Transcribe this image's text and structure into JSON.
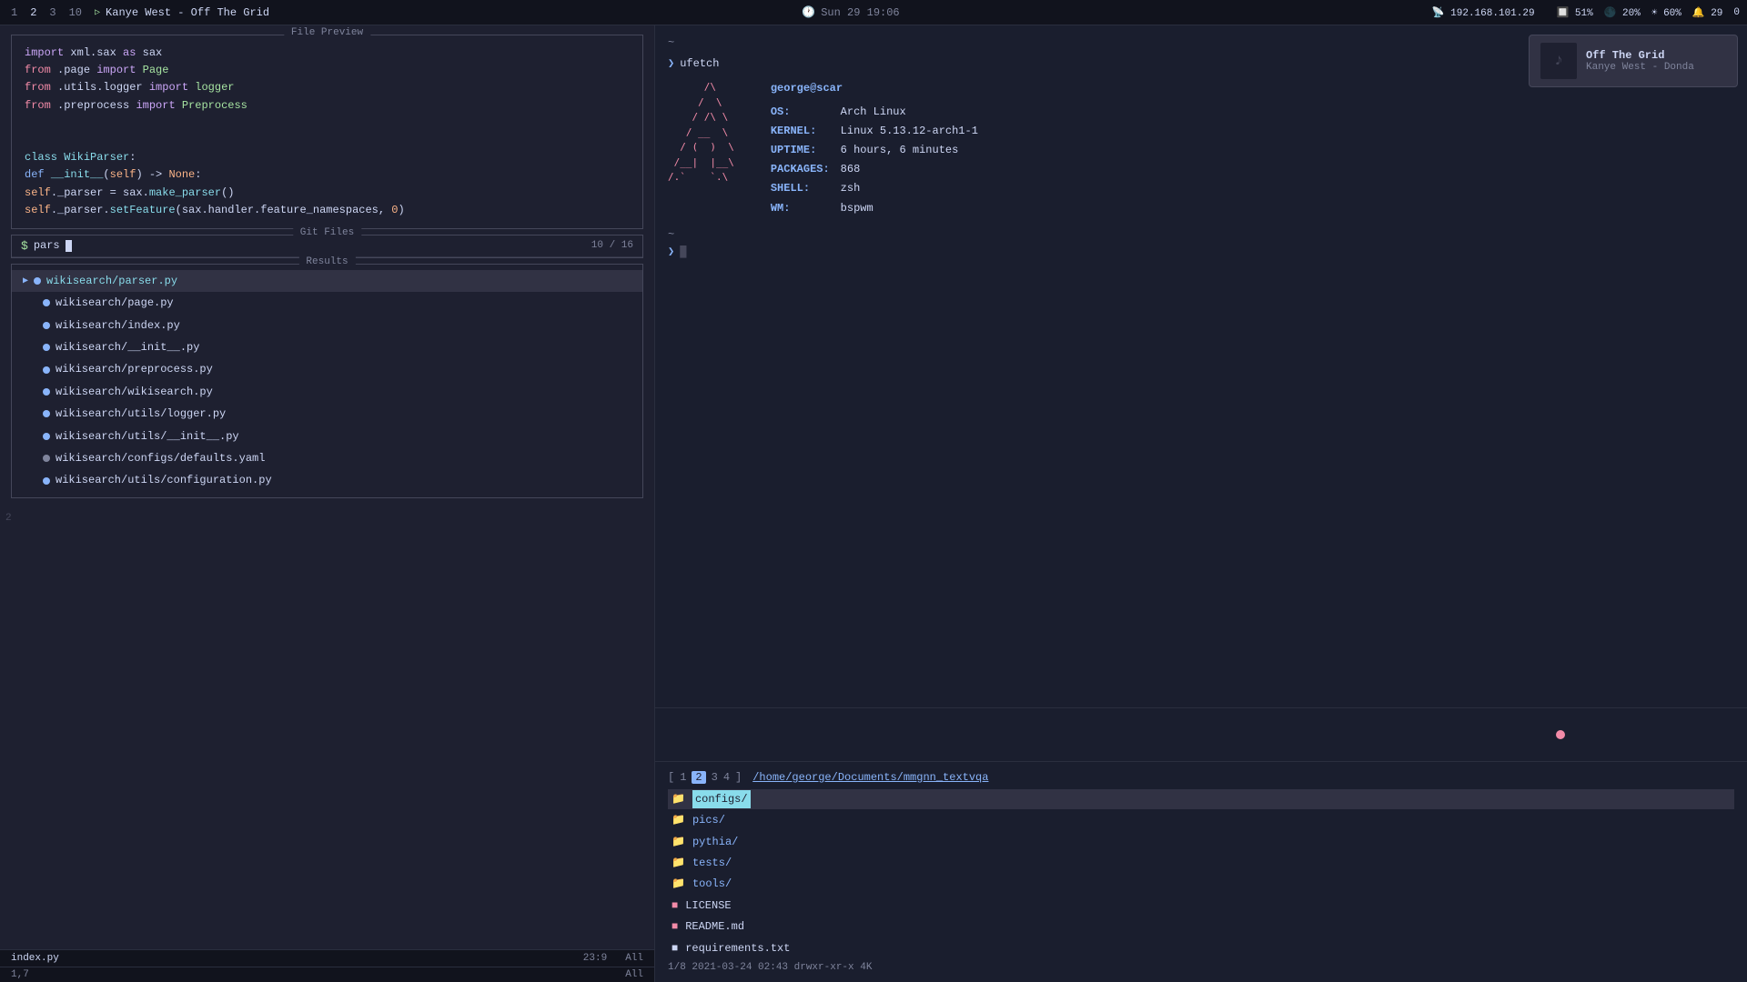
{
  "topbar": {
    "workspaces": [
      "1",
      "2",
      "3",
      "10"
    ],
    "active_ws": "1",
    "song_title": "Kanye West - Off The Grid",
    "time": "Sun 29 19:06",
    "ip": "192.168.101.29",
    "cpu": "51%",
    "brightness": "20%",
    "sun": "60%",
    "notifications": "29",
    "extra": "0"
  },
  "music_notif": {
    "title": "Off The Grid",
    "artist": "Kanye West - Donda"
  },
  "file_preview": {
    "title": "File Preview",
    "lines": [
      "import xml.sax as sax",
      "from .page import Page",
      "from .utils.logger import logger",
      "from .preprocess import Preprocess",
      "",
      "",
      "class WikiParser:",
      "    def __init__(self) -> None:",
      "        self._parser = sax.make_parser()",
      "        self._parser.setFeature(sax.handler.feature_namespaces, 0)"
    ]
  },
  "git_files": {
    "title": "Git Files",
    "search_prompt": "$",
    "search_text": "pars",
    "count": "10 / 16"
  },
  "results": {
    "title": "Results",
    "items": [
      {
        "name": "wikisearch/parser.py",
        "icon": "arrow",
        "color": "blue",
        "selected": true
      },
      {
        "name": "wikisearch/page.py",
        "icon": "dot",
        "color": "blue",
        "selected": false
      },
      {
        "name": "wikisearch/index.py",
        "icon": "dot",
        "color": "blue",
        "selected": false
      },
      {
        "name": "wikisearch/__init__.py",
        "icon": "dot",
        "color": "blue",
        "selected": false
      },
      {
        "name": "wikisearch/preprocess.py",
        "icon": "dot",
        "color": "blue",
        "selected": false
      },
      {
        "name": "wikisearch/wikisearch.py",
        "icon": "dot",
        "color": "blue",
        "selected": false
      },
      {
        "name": "wikisearch/utils/logger.py",
        "icon": "dot",
        "color": "blue",
        "selected": false
      },
      {
        "name": "wikisearch/utils/__init__.py",
        "icon": "dot",
        "color": "blue",
        "selected": false
      },
      {
        "name": "wikisearch/configs/defaults.yaml",
        "icon": "dot",
        "color": "gray",
        "selected": false
      },
      {
        "name": "wikisearch/utils/configuration.py",
        "icon": "dot",
        "color": "blue",
        "selected": false
      }
    ]
  },
  "statusbar": {
    "filename": "index.py",
    "pos_left": "23:9",
    "pos_right": "All",
    "bottom_pos": "1,7"
  },
  "terminal": {
    "ufetch_cmd": "ufetch",
    "ascii_art": "      /\\      \n     /  \\     \n    / /\\ \\    \n   / __  \\   \n  / (  )  \\  \n /__|  |__\\ \n/.`    `.\\",
    "user": "george@scar",
    "os_label": "OS:",
    "os_value": "Arch Linux",
    "kernel_label": "KERNEL:",
    "kernel_value": "Linux 5.13.12-arch1-1",
    "uptime_label": "UPTIME:",
    "uptime_value": "6 hours, 6 minutes",
    "packages_label": "PACKAGES:",
    "packages_value": "868",
    "shell_label": "SHELL:",
    "shell_value": "zsh",
    "wm_label": "WM:",
    "wm_value": "bspwm"
  },
  "file_manager": {
    "tabs": [
      "1",
      "2",
      "3",
      "4"
    ],
    "active_tab": "2",
    "path": "/home/george/Documents/mmgnn_textvqa",
    "entries": [
      {
        "name": "configs/",
        "type": "folder",
        "highlighted": true
      },
      {
        "name": "pics/",
        "type": "folder",
        "highlighted": false
      },
      {
        "name": "pythia/",
        "type": "folder",
        "highlighted": false
      },
      {
        "name": "tests/",
        "type": "folder",
        "highlighted": false
      },
      {
        "name": "tools/",
        "type": "folder",
        "highlighted": false
      },
      {
        "name": "LICENSE",
        "type": "license",
        "highlighted": false
      },
      {
        "name": "README.md",
        "type": "readme",
        "highlighted": false
      },
      {
        "name": "requirements.txt",
        "type": "file",
        "highlighted": false
      }
    ],
    "statusbar": "1/8  2021-03-24  02:43  drwxr-xr-x  4K"
  }
}
